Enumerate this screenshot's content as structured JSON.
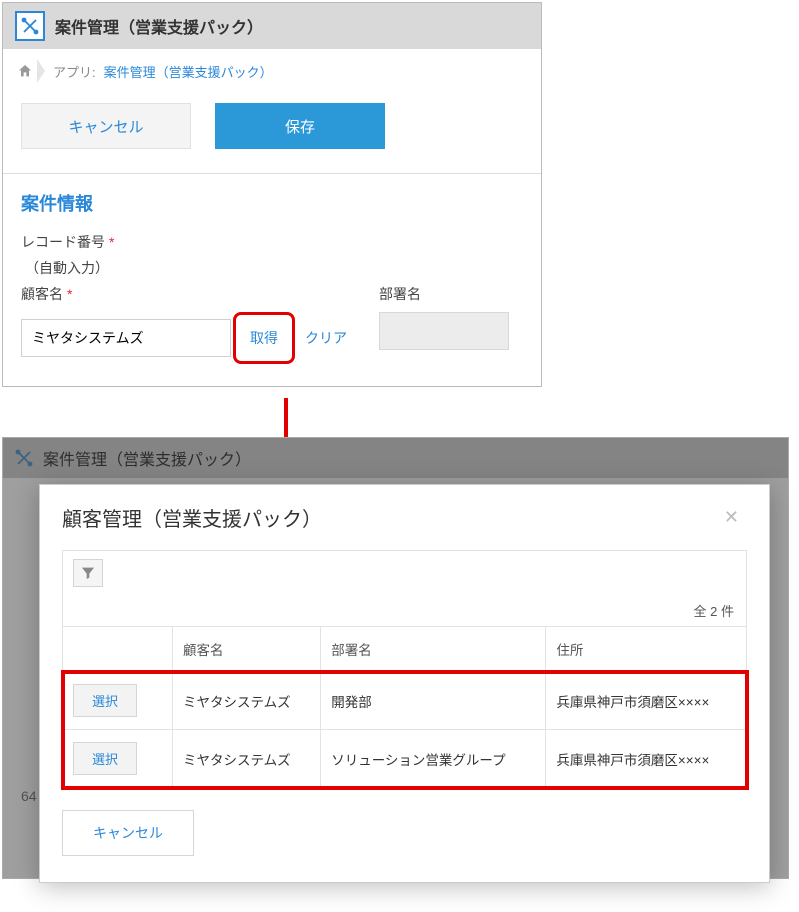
{
  "top": {
    "title": "案件管理（営業支援パック）",
    "breadcrumb_prefix": "アプリ: ",
    "breadcrumb_link": "案件管理（営業支援パック）",
    "cancel": "キャンセル",
    "save": "保存",
    "section": "案件情報",
    "record_no_label": "レコード番号",
    "record_no_auto": "（自動入力）",
    "customer_label": "顧客名",
    "customer_value": "ミヤタシステムズ",
    "fetch": "取得",
    "clear": "クリア",
    "dept_label": "部署名"
  },
  "bottom": {
    "app_title": "案件管理（営業支援パック）",
    "behind_text_prefix": "64",
    "modal": {
      "title": "顧客管理（営業支援パック）",
      "count": "全 2 件",
      "columns": {
        "c1": "顧客名",
        "c2": "部署名",
        "c3": "住所"
      },
      "select_label": "選択",
      "rows": [
        {
          "customer": "ミヤタシステムズ",
          "dept": "開発部",
          "addr": "兵庫県神戸市須磨区××××"
        },
        {
          "customer": "ミヤタシステムズ",
          "dept": "ソリューション営業グループ",
          "addr": "兵庫県神戸市須磨区××××"
        }
      ],
      "cancel": "キャンセル"
    }
  }
}
